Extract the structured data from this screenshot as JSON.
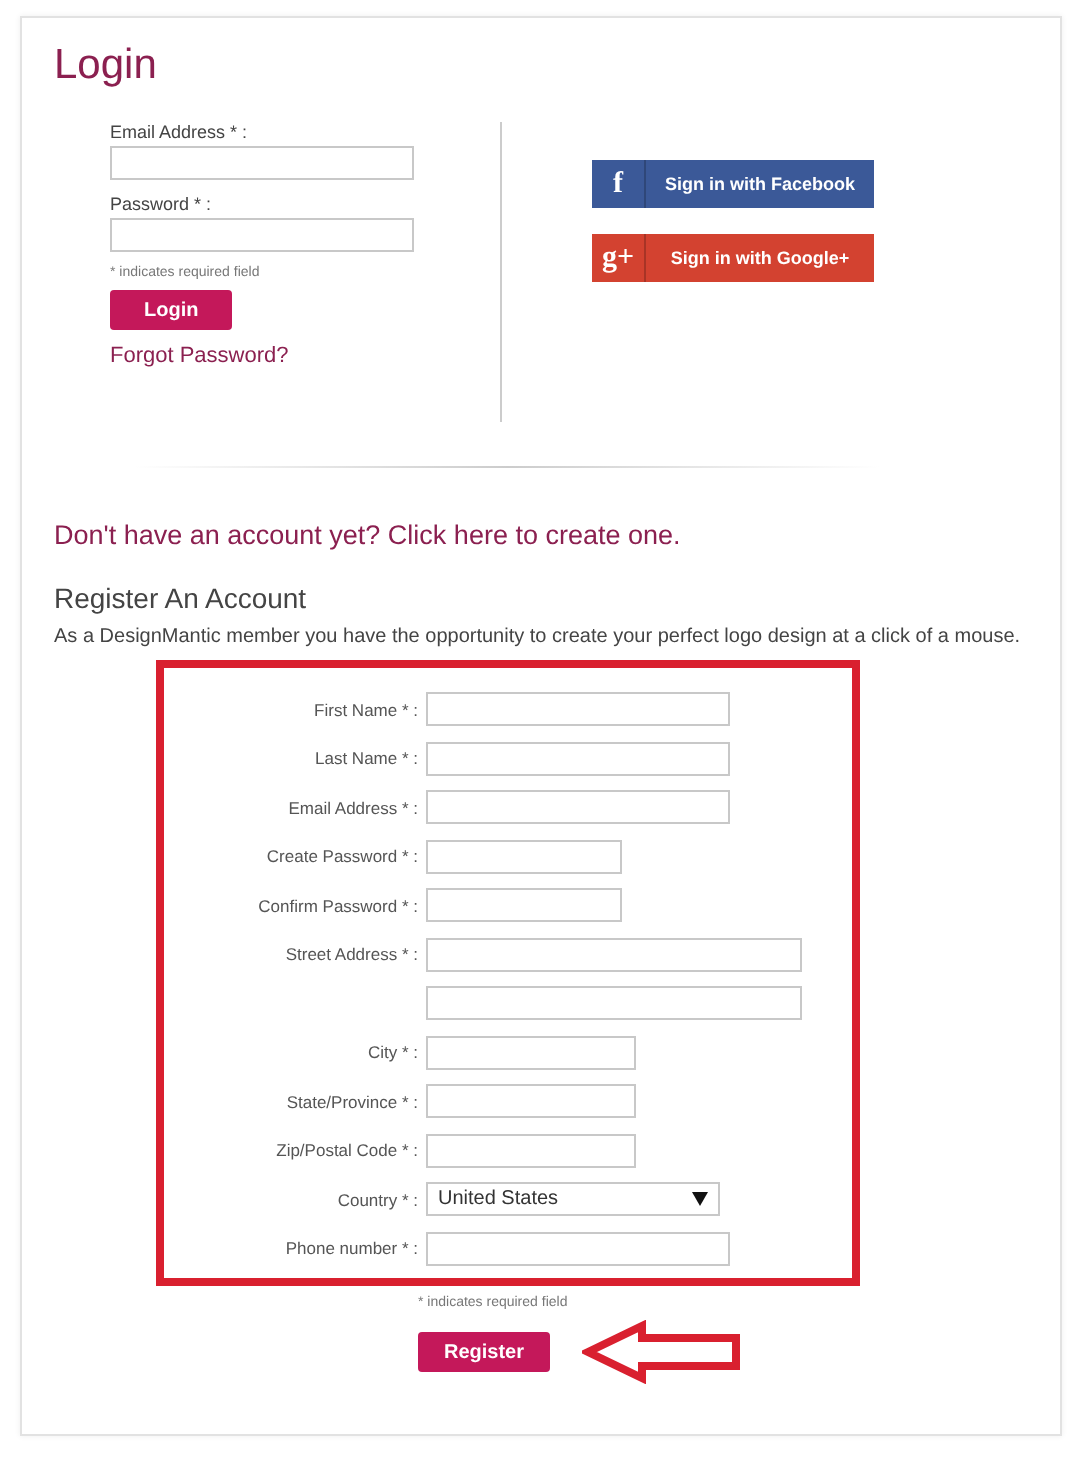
{
  "login": {
    "title": "Login",
    "fields": [
      {
        "label": "Email Address * :"
      },
      {
        "label": "Password * :"
      }
    ],
    "note": "* indicates required field",
    "button": "Login",
    "forgot_link": "Forgot Password?",
    "social_buttons": [
      {
        "kind": "facebook",
        "icon": "f",
        "label": "Sign in with Facebook"
      },
      {
        "kind": "google",
        "icon": "g+",
        "label": "Sign in with Google+"
      }
    ]
  },
  "create_link": "Don't have an account yet? Click here to create one.",
  "register": {
    "title": "Register An Account",
    "intro": "As a DesignMantic member you have the opportunity to create your perfect logo design at a click of a mouse.",
    "fields": [
      {
        "label": "First Name * :",
        "kind": "long"
      },
      {
        "label": "Last Name * :",
        "kind": "long"
      },
      {
        "label": "Email Address * :",
        "kind": "long"
      },
      {
        "label": "Create Password * :",
        "kind": "medium"
      },
      {
        "label": "Confirm Password * :",
        "kind": "medium"
      },
      {
        "label": "Street Address * :",
        "kind": "wide"
      },
      {
        "kind": "wide"
      },
      {
        "label": "City * :",
        "kind": "short"
      },
      {
        "label": "State/Province * :",
        "kind": "short"
      },
      {
        "label": "Zip/Postal Code * :",
        "kind": "short"
      },
      {
        "label": "Country * :",
        "kind": "select",
        "value": "United States"
      },
      {
        "label": "Phone number * :",
        "kind": "long"
      }
    ],
    "note": "* indicates required field",
    "button": "Register"
  }
}
